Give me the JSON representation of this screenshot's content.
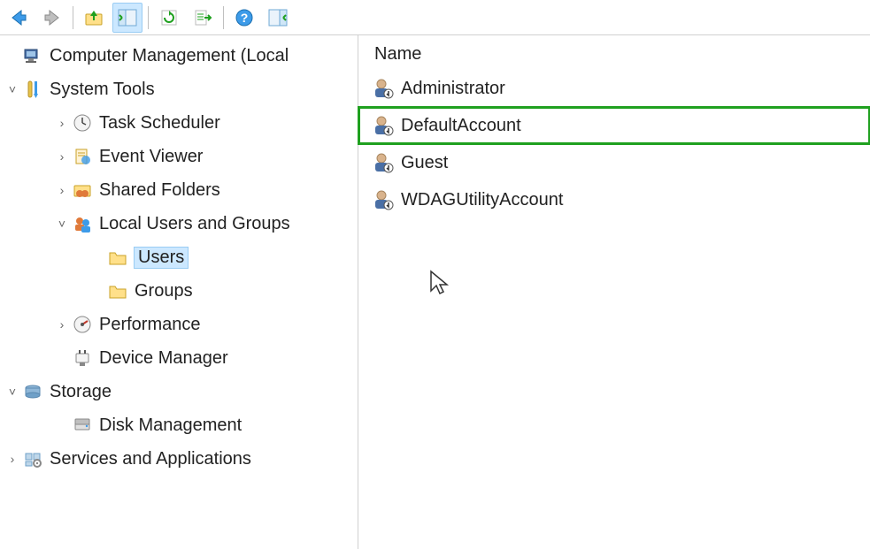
{
  "toolbar": {
    "back": "Back",
    "forward": "Forward",
    "up": "Up One Level",
    "show_hide": "Show/Hide Console Tree",
    "refresh": "Refresh",
    "export": "Export List",
    "help": "Help",
    "actions": "Show/Hide Action Pane"
  },
  "tree": {
    "root": {
      "label": "Computer Management (Local"
    },
    "system_tools": {
      "label": "System Tools"
    },
    "task_scheduler": {
      "label": "Task Scheduler"
    },
    "event_viewer": {
      "label": "Event Viewer"
    },
    "shared_folders": {
      "label": "Shared Folders"
    },
    "local_users_groups": {
      "label": "Local Users and Groups"
    },
    "users": {
      "label": "Users"
    },
    "groups": {
      "label": "Groups"
    },
    "performance": {
      "label": "Performance"
    },
    "device_manager": {
      "label": "Device Manager"
    },
    "storage": {
      "label": "Storage"
    },
    "disk_management": {
      "label": "Disk Management"
    },
    "services_apps": {
      "label": "Services and Applications"
    }
  },
  "list": {
    "header": {
      "name": "Name"
    },
    "items": [
      {
        "label": "Administrator"
      },
      {
        "label": "DefaultAccount"
      },
      {
        "label": "Guest"
      },
      {
        "label": "WDAGUtilityAccount"
      }
    ],
    "highlighted_index": 1
  }
}
